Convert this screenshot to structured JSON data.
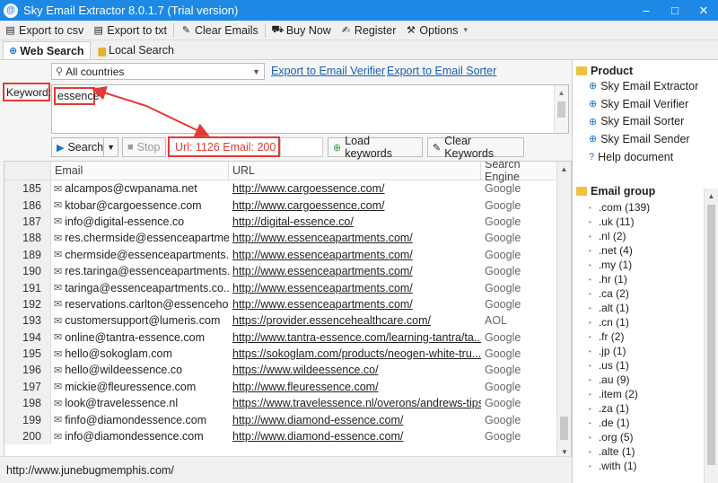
{
  "window": {
    "title": "Sky Email Extractor 8.0.1.7 (Trial version)",
    "min": "–",
    "max": "□",
    "close": "✕"
  },
  "menu": [
    {
      "label": "Export to csv",
      "icon": "csv-export-icon",
      "glyph": "▤"
    },
    {
      "label": "Export to txt",
      "icon": "txt-export-icon",
      "glyph": "▤"
    },
    {
      "label": "Clear Emails",
      "icon": "brush-icon",
      "glyph": "✎"
    },
    {
      "label": "Buy Now",
      "icon": "cart-icon",
      "glyph": "⚒"
    },
    {
      "label": "Register",
      "icon": "key-icon",
      "glyph": "✍"
    },
    {
      "label": "Options",
      "icon": "wrench-icon",
      "glyph": "⚒",
      "dropdown": "▾"
    }
  ],
  "tabs": {
    "web": "Web Search",
    "local": "Local Search"
  },
  "search": {
    "country": "All countries",
    "link_verifier": "Export to Email Verifier",
    "link_sorter": "Export to Email Sorter",
    "keyword_label": "Keyword:",
    "keyword_value": "essence",
    "search_btn": "Search",
    "stop_btn": "Stop",
    "stat": "Url: 1126 Email: 200",
    "load_btn": "Load keywords",
    "clear_kw_btn": "Clear Keywords"
  },
  "grid": {
    "headers": {
      "email": "Email",
      "url": "URL",
      "engine": "Search Engine"
    },
    "rows": [
      {
        "n": "185",
        "email": "alcampos@cwpanama.net",
        "url": "http://www.cargoessence.com/",
        "engine": "Google"
      },
      {
        "n": "186",
        "email": "ktobar@cargoessence.com",
        "url": "http://www.cargoessence.com/",
        "engine": "Google"
      },
      {
        "n": "187",
        "email": "info@digital-essence.co",
        "url": "http://digital-essence.co/",
        "engine": "Google"
      },
      {
        "n": "188",
        "email": "res.chermside@essenceapartme...",
        "url": "http://www.essenceapartments.com/",
        "engine": "Google"
      },
      {
        "n": "189",
        "email": "chermside@essenceapartments....",
        "url": "http://www.essenceapartments.com/",
        "engine": "Google"
      },
      {
        "n": "190",
        "email": "res.taringa@essenceapartments....",
        "url": "http://www.essenceapartments.com/",
        "engine": "Google"
      },
      {
        "n": "191",
        "email": "taringa@essenceapartments.co...",
        "url": "http://www.essenceapartments.com/",
        "engine": "Google"
      },
      {
        "n": "192",
        "email": "reservations.carlton@essenceho...",
        "url": "http://www.essenceapartments.com/",
        "engine": "Google"
      },
      {
        "n": "193",
        "email": "customersupport@lumeris.com",
        "url": "https://provider.essencehealthcare.com/",
        "engine": "AOL"
      },
      {
        "n": "194",
        "email": "online@tantra-essence.com",
        "url": "http://www.tantra-essence.com/learning-tantra/ta...",
        "engine": "Google"
      },
      {
        "n": "195",
        "email": "hello@sokoglam.com",
        "url": "https://sokoglam.com/products/neogen-white-tru...",
        "engine": "Google"
      },
      {
        "n": "196",
        "email": "hello@wildeessence.co",
        "url": "https://www.wildeessence.co/",
        "engine": "Google"
      },
      {
        "n": "197",
        "email": "mickie@fleuressence.com",
        "url": "http://www.fleuressence.com/",
        "engine": "Google"
      },
      {
        "n": "198",
        "email": "look@travelessence.nl",
        "url": "https://www.travelessence.nl/overons/andrews-tips/",
        "engine": "Google"
      },
      {
        "n": "199",
        "email": "finfo@diamondessence.com",
        "url": "http://www.diamond-essence.com/",
        "engine": "Google"
      },
      {
        "n": "200",
        "email": "info@diamondessence.com",
        "url": "http://www.diamond-essence.com/",
        "engine": "Google"
      }
    ]
  },
  "status": "http://www.junebugmemphis.com/",
  "product": {
    "title": "Product",
    "items": [
      "Sky Email Extractor",
      "Sky Email Verifier",
      "Sky Email Sorter",
      "Sky Email Sender",
      "Help document"
    ]
  },
  "group": {
    "title": "Email group",
    "items": [
      ".com (139)",
      ".uk (11)",
      ".nl (2)",
      ".net (4)",
      ".my (1)",
      ".hr (1)",
      ".ca (2)",
      ".alt (1)",
      ".cn (1)",
      ".fr (2)",
      ".jp (1)",
      ".us (1)",
      ".au (9)",
      ".item (2)",
      ".za (1)",
      ".de (1)",
      ".org (5)",
      ".alte (1)",
      ".with (1)"
    ]
  },
  "colors": {
    "titlebar": "#1e88e5",
    "highlight": "#e53935",
    "link": "#1a5fb4"
  }
}
